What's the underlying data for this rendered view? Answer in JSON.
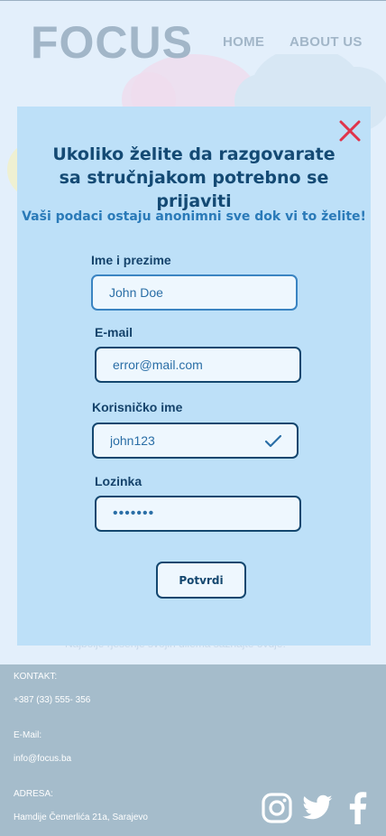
{
  "header": {
    "logo": "FOCUS",
    "nav": {
      "home": "HOME",
      "about": "ABOUT US"
    }
  },
  "background_text": "Najbolje rješenje svojih dilema saznajte ovdje!",
  "modal": {
    "title": "Ukoliko želite da razgovarate sa stručnjakom potrebno se prijaviti",
    "subtitle": "Vaši podaci ostaju anonimni sve dok vi to želite!",
    "fields": {
      "name": {
        "label": "Ime i prezime",
        "value": "John Doe"
      },
      "email": {
        "label": "E-mail",
        "value": "error@mail.com"
      },
      "username": {
        "label": "Korisničko ime",
        "value": "john123"
      },
      "password": {
        "label": "Lozinka",
        "value": "•••••••"
      }
    },
    "submit_label": "Potvrdi",
    "icons": {
      "close": "close-icon",
      "valid": "check-icon"
    }
  },
  "footer": {
    "contact_label": "KONTAKT:",
    "phone": "+387 (33) 555- 356",
    "email_label": "E-Mail:",
    "email": "info@focus.ba",
    "address_label": "ADRESA:",
    "address": "Hamdije Čemerlića 21a, Sarajevo",
    "social_icons": [
      "instagram-icon",
      "twitter-icon",
      "facebook-icon"
    ]
  },
  "colors": {
    "modal_bg": "#bde0f8",
    "accent_dark": "#14476f",
    "close": "#e0344b",
    "footer_bg": "#a5bccb"
  }
}
